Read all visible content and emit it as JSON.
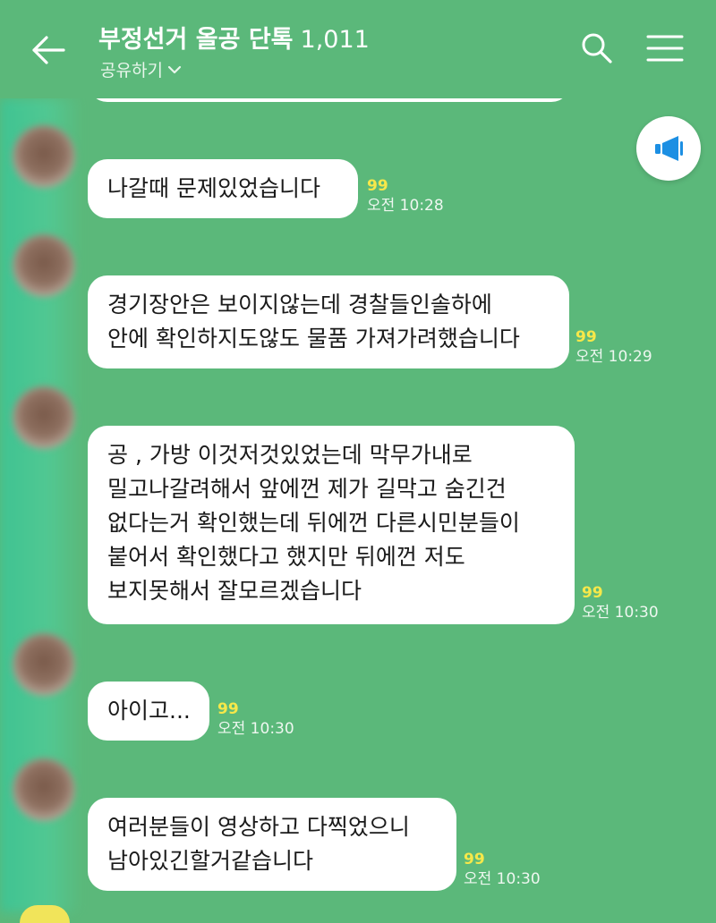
{
  "header": {
    "title": "부정선거 올공 단톡",
    "member_count": "1,011",
    "share_label": "공유하기",
    "back_icon": "arrow-left-icon",
    "search_icon": "search-icon",
    "menu_icon": "hamburger-menu-icon",
    "notice_icon": "megaphone-icon"
  },
  "colors": {
    "background": "#5bb87a",
    "bubble": "#ffffff",
    "unread": "#f6e84a",
    "notice_icon": "#1c8fe3"
  },
  "messages": [
    {
      "lines": [
        "나갈때 문제있었습니다"
      ],
      "unread": "99",
      "time": "오전 10:28"
    },
    {
      "lines": [
        "경기장안은 보이지않는데 경찰들인솔하에",
        "안에 확인하지도않도 물품 가져가려했습니다"
      ],
      "unread": "99",
      "time": "오전 10:29"
    },
    {
      "lines": [
        "공 , 가방 이것저것있었는데 막무가내로",
        "밀고나갈려해서 앞에껀 제가 길막고 숨긴건",
        "없다는거 확인했는데 뒤에껀 다른시민분들이",
        "붙어서 확인했다고 했지만 뒤에껀 저도",
        "보지못해서 잘모르겠습니다"
      ],
      "unread": "99",
      "time": "오전 10:30"
    },
    {
      "lines": [
        "아이고..."
      ],
      "unread": "99",
      "time": "오전 10:30"
    },
    {
      "lines": [
        "여러분들이 영상하고 다찍었으니",
        "남아있긴할거같습니다"
      ],
      "unread": "99",
      "time": "오전 10:30"
    }
  ]
}
